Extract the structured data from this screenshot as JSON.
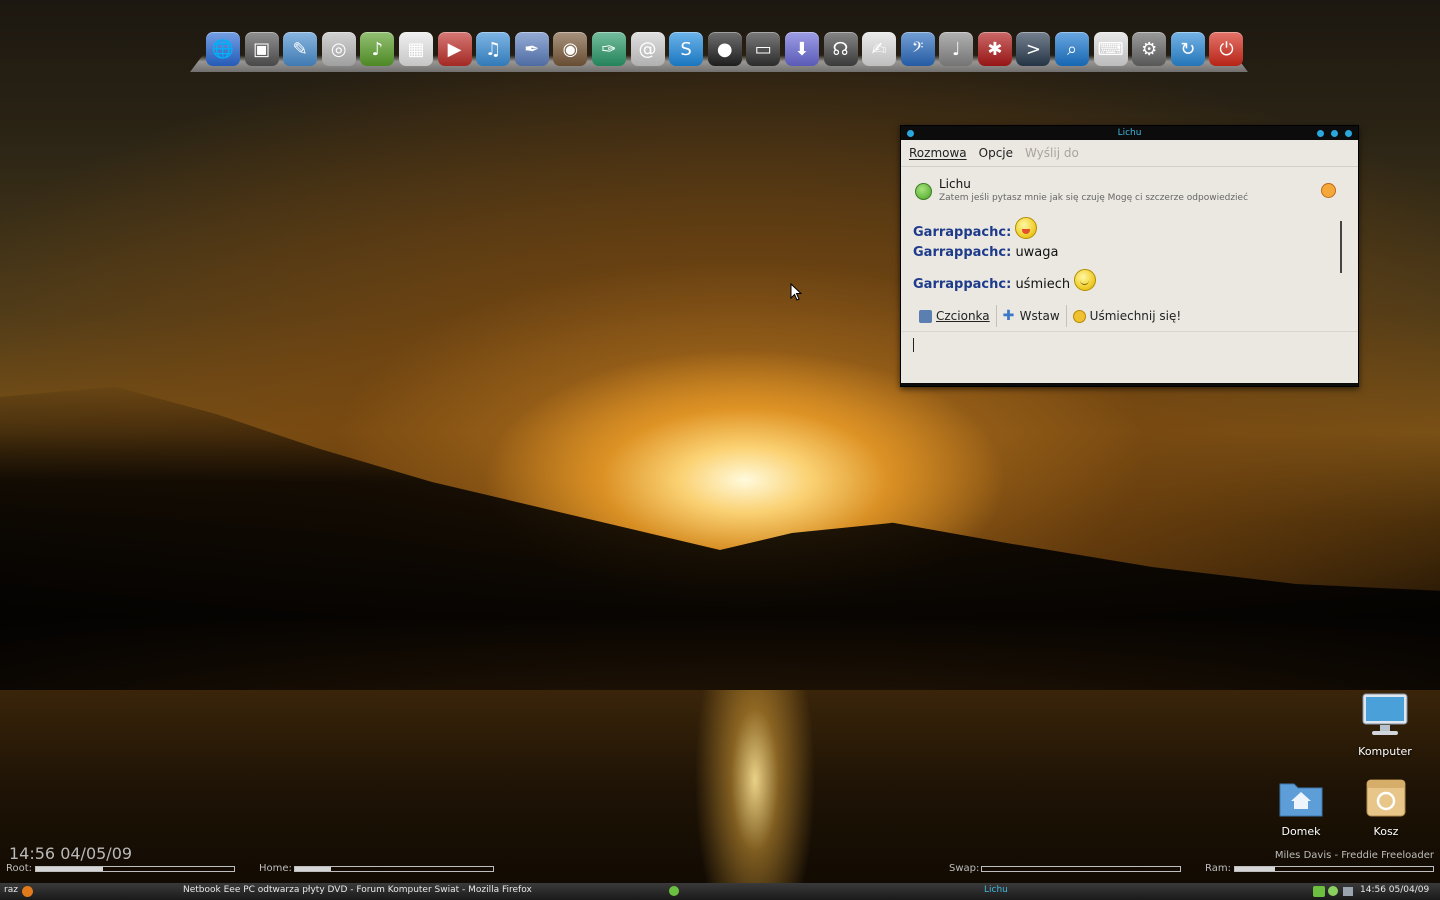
{
  "dock": {
    "icons": [
      {
        "name": "web-browser-icon",
        "glyph": "🌐",
        "color": "#2a6bd6"
      },
      {
        "name": "display-settings-icon",
        "glyph": "▣",
        "color": "#555555"
      },
      {
        "name": "image-editor-icon",
        "glyph": "✎",
        "color": "#4a8fd0"
      },
      {
        "name": "cd-burner-icon",
        "glyph": "◎",
        "color": "#bbbbbb"
      },
      {
        "name": "music-editor-icon",
        "glyph": "♪",
        "color": "#5aa02a"
      },
      {
        "name": "calendar-icon",
        "glyph": "▦",
        "color": "#e8e8e8"
      },
      {
        "name": "video-app-icon",
        "glyph": "▶",
        "color": "#c0302a"
      },
      {
        "name": "itunes-icon",
        "glyph": "♫",
        "color": "#3a8fd8"
      },
      {
        "name": "feather-writer-icon",
        "glyph": "✒",
        "color": "#5c7fbf"
      },
      {
        "name": "photo-camera-icon",
        "glyph": "◉",
        "color": "#7a5a3a"
      },
      {
        "name": "scan-pen-icon",
        "glyph": "✑",
        "color": "#2a9a6a"
      },
      {
        "name": "email-icon",
        "glyph": "@",
        "color": "#cfcfcf"
      },
      {
        "name": "skype-icon",
        "glyph": "S",
        "color": "#1e8be0"
      },
      {
        "name": "webcam-icon",
        "glyph": "●",
        "color": "#222222"
      },
      {
        "name": "tape-player-icon",
        "glyph": "▭",
        "color": "#333333"
      },
      {
        "name": "download-icon",
        "glyph": "⬇",
        "color": "#6a6ad8"
      },
      {
        "name": "headphones-icon",
        "glyph": "☊",
        "color": "#444444"
      },
      {
        "name": "notes-icon",
        "glyph": "✍",
        "color": "#e0e0e0"
      },
      {
        "name": "audio-bass-icon",
        "glyph": "𝄢",
        "color": "#2a6bbf"
      },
      {
        "name": "microphone-icon",
        "glyph": "♩",
        "color": "#888888"
      },
      {
        "name": "terminal-flag-icon",
        "glyph": "✱",
        "color": "#b01818"
      },
      {
        "name": "terminal-icon",
        "glyph": ">",
        "color": "#2b3d52"
      },
      {
        "name": "search-icon",
        "glyph": "⌕",
        "color": "#1a78d0"
      },
      {
        "name": "keyboard-icon",
        "glyph": "⌨",
        "color": "#dddddd"
      },
      {
        "name": "settings-gear-icon",
        "glyph": "⚙",
        "color": "#666666"
      },
      {
        "name": "refresh-icon",
        "glyph": "↻",
        "color": "#2a8ad8"
      },
      {
        "name": "power-icon",
        "glyph": "⏻",
        "color": "#d62a1a"
      }
    ]
  },
  "chat_window": {
    "title": "Lichu",
    "menu": {
      "conversation": "Rozmowa",
      "options": "Opcje",
      "send_to": "Wyślij do"
    },
    "contact": {
      "name": "Lichu",
      "status_message": "Zatem jeśli pytasz mnie jak się czuję Mogę ci szczerze odpowiedzieć"
    },
    "messages": [
      {
        "sender": "Garrappachc:",
        "text": "",
        "emoticon": "tongue"
      },
      {
        "sender": "Garrappachc:",
        "text": "uwaga",
        "emoticon": ""
      },
      {
        "sender": "Garrappachc:",
        "text": "uśmiech",
        "emoticon": "smile"
      }
    ],
    "toolbar": {
      "font": "Czcionka",
      "insert": "Wstaw",
      "smile": "Uśmiechnij się!"
    }
  },
  "desktop": {
    "icons": [
      {
        "label": "Komputer"
      },
      {
        "label": "Domek"
      },
      {
        "label": "Kosz"
      }
    ]
  },
  "conky": {
    "datetime": "14:56 04/05/09",
    "root_label": "Root:",
    "root_usage": 0.34,
    "home_label": "Home:",
    "home_usage": 0.18,
    "swap_label": "Swap:",
    "swap_usage": 0.0,
    "ram_label": "Ram:",
    "ram_usage": 0.2,
    "now_playing": "Miles Davis - Freddie Freeloader"
  },
  "panel": {
    "workspace": "raz",
    "task_firefox": "Netbook Eee PC odtwarza płyty DVD - Forum Komputer Swiat - Mozilla Firefox",
    "task_chat": "Lichu",
    "clock": "14:56 05/04/09"
  }
}
